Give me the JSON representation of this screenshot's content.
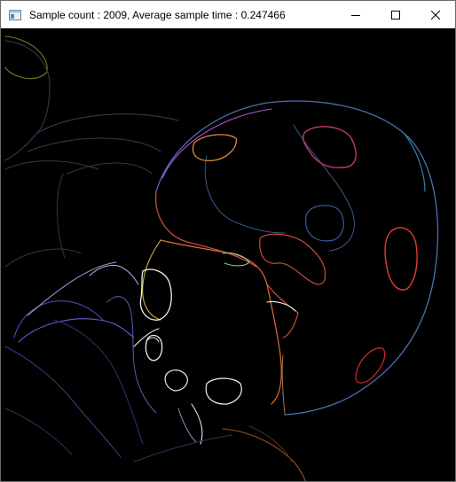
{
  "window": {
    "title": "Sample count : 2009, Average sample time : 0.247466",
    "app_icon": "window-app-icon",
    "buttons": {
      "minimize_icon": "minimize-icon",
      "maximize_icon": "maximize-icon",
      "close_icon": "close-icon"
    }
  },
  "canvas": {
    "background": "#000000",
    "content": "edge-detection render of a ladybug on leaves"
  }
}
